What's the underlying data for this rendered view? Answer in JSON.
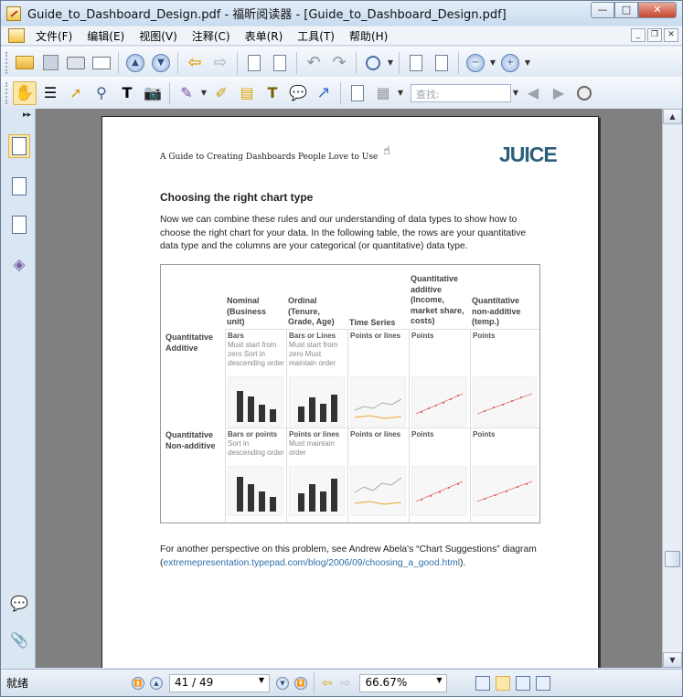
{
  "window": {
    "title": "Guide_to_Dashboard_Design.pdf - 福昕阅读器 - [Guide_to_Dashboard_Design.pdf]",
    "minimize": "—",
    "maximize": "□",
    "close": "✕"
  },
  "menu": [
    "文件(F)",
    "编辑(E)",
    "视图(V)",
    "注释(C)",
    "表单(R)",
    "工具(T)",
    "帮助(H)"
  ],
  "mdi": {
    "minimize": "_",
    "restore": "❐",
    "close": "✕"
  },
  "search": {
    "placeholder": "查找:"
  },
  "sidebar": {
    "collapse": "▸▸"
  },
  "status": {
    "ready": "就绪",
    "page": "41 / 49",
    "zoom": "66.67%"
  },
  "page": {
    "header": "A Guide to Creating Dashboards People Love to Use",
    "logo": "JUICE",
    "title": "Choosing the right chart type",
    "paragraph": "Now we can combine these rules and our understanding of data types to show how to choose the right chart for your data. In the following table, the rows are your quantitative data type and the columns are your categorical (or quantitative) data type.",
    "footer_text": "For another perspective on this problem, see Andrew Abela's “Chart Suggestions” diagram (",
    "footer_link": "extremepresentation.typepad.com/blog/2006/09/choosing_a_good.html",
    "footer_end": ").",
    "table": {
      "columns": [
        "Nominal (Business unit)",
        "Ordinal (Tenure, Grade, Age)",
        "Time Series",
        "Quantitative additive (Income, market share, costs)",
        "Quantitative non-additive (temp.)"
      ],
      "rows": [
        {
          "label": "Quantitative Additive",
          "cells": [
            {
              "head": "Bars",
              "note": "Must start from zero Sort in descending order"
            },
            {
              "head": "Bars or Lines",
              "note": "Must start from zero Must maintain order"
            },
            {
              "head": "Points or lines",
              "note": ""
            },
            {
              "head": "Points",
              "note": ""
            },
            {
              "head": "Points",
              "note": ""
            }
          ]
        },
        {
          "label": "Quantitative Non-additive",
          "cells": [
            {
              "head": "Bars or points",
              "note": "Sort in descending order"
            },
            {
              "head": "Points or lines",
              "note": "Must maintain order"
            },
            {
              "head": "Points or lines",
              "note": ""
            },
            {
              "head": "Points",
              "note": ""
            },
            {
              "head": "Points",
              "note": ""
            }
          ]
        }
      ]
    }
  }
}
